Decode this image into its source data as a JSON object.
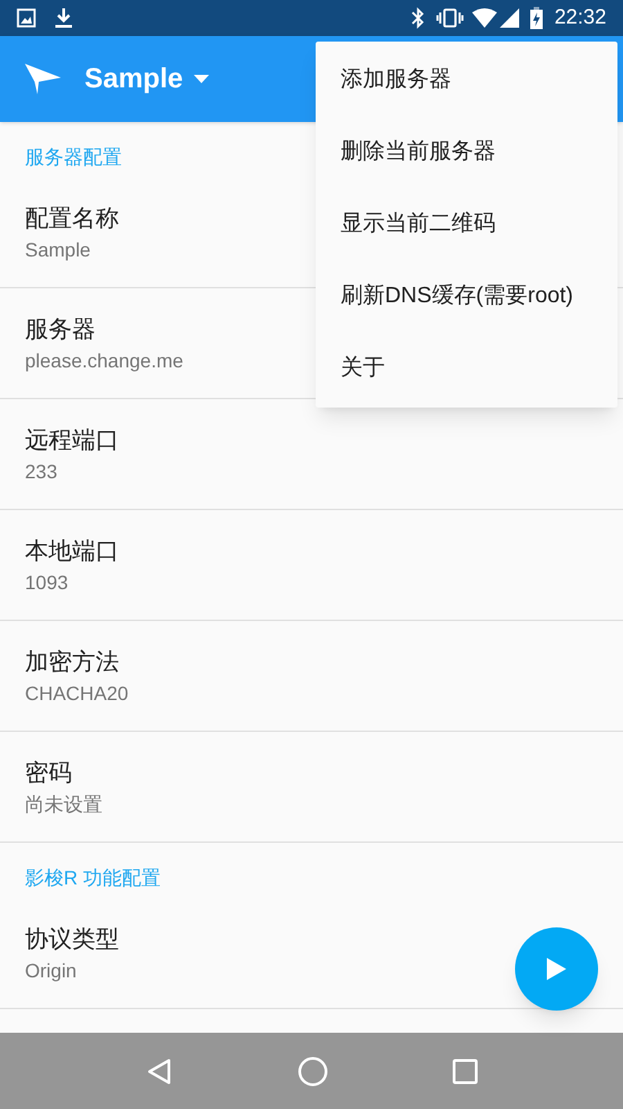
{
  "status_bar": {
    "time": "22:32"
  },
  "app_bar": {
    "title": "Sample"
  },
  "sections": [
    {
      "header": "服务器配置",
      "items": [
        {
          "title": "配置名称",
          "value": "Sample"
        },
        {
          "title": "服务器",
          "value": "please.change.me"
        },
        {
          "title": "远程端口",
          "value": "233"
        },
        {
          "title": "本地端口",
          "value": "1093"
        },
        {
          "title": "加密方法",
          "value": "CHACHA20"
        },
        {
          "title": "密码",
          "value": "尚未设置"
        }
      ]
    },
    {
      "header": "影梭R 功能配置",
      "items": [
        {
          "title": "协议类型",
          "value": "Origin"
        }
      ]
    }
  ],
  "menu": {
    "items": [
      "添加服务器",
      "删除当前服务器",
      "显示当前二维码",
      "刷新DNS缓存(需要root)",
      "关于"
    ]
  }
}
